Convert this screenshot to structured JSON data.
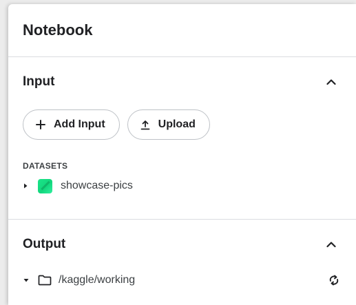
{
  "panel": {
    "title": "Notebook"
  },
  "input_section": {
    "title": "Input",
    "add_input_label": "Add Input",
    "upload_label": "Upload",
    "datasets_heading": "DATASETS",
    "datasets": [
      {
        "name": "showcase-pics"
      }
    ]
  },
  "output_section": {
    "title": "Output",
    "path": "/kaggle/working"
  },
  "colors": {
    "dataset_icon": "#1ce58a",
    "border": "#dadce0",
    "text": "#202124"
  },
  "icons": {
    "collapse": "chevron-up-icon",
    "add": "plus-icon",
    "upload": "upload-icon",
    "expand_right": "caret-right-icon",
    "expand_down": "caret-down-icon",
    "dataset": "dataset-icon",
    "folder": "folder-icon",
    "refresh": "refresh-icon"
  }
}
